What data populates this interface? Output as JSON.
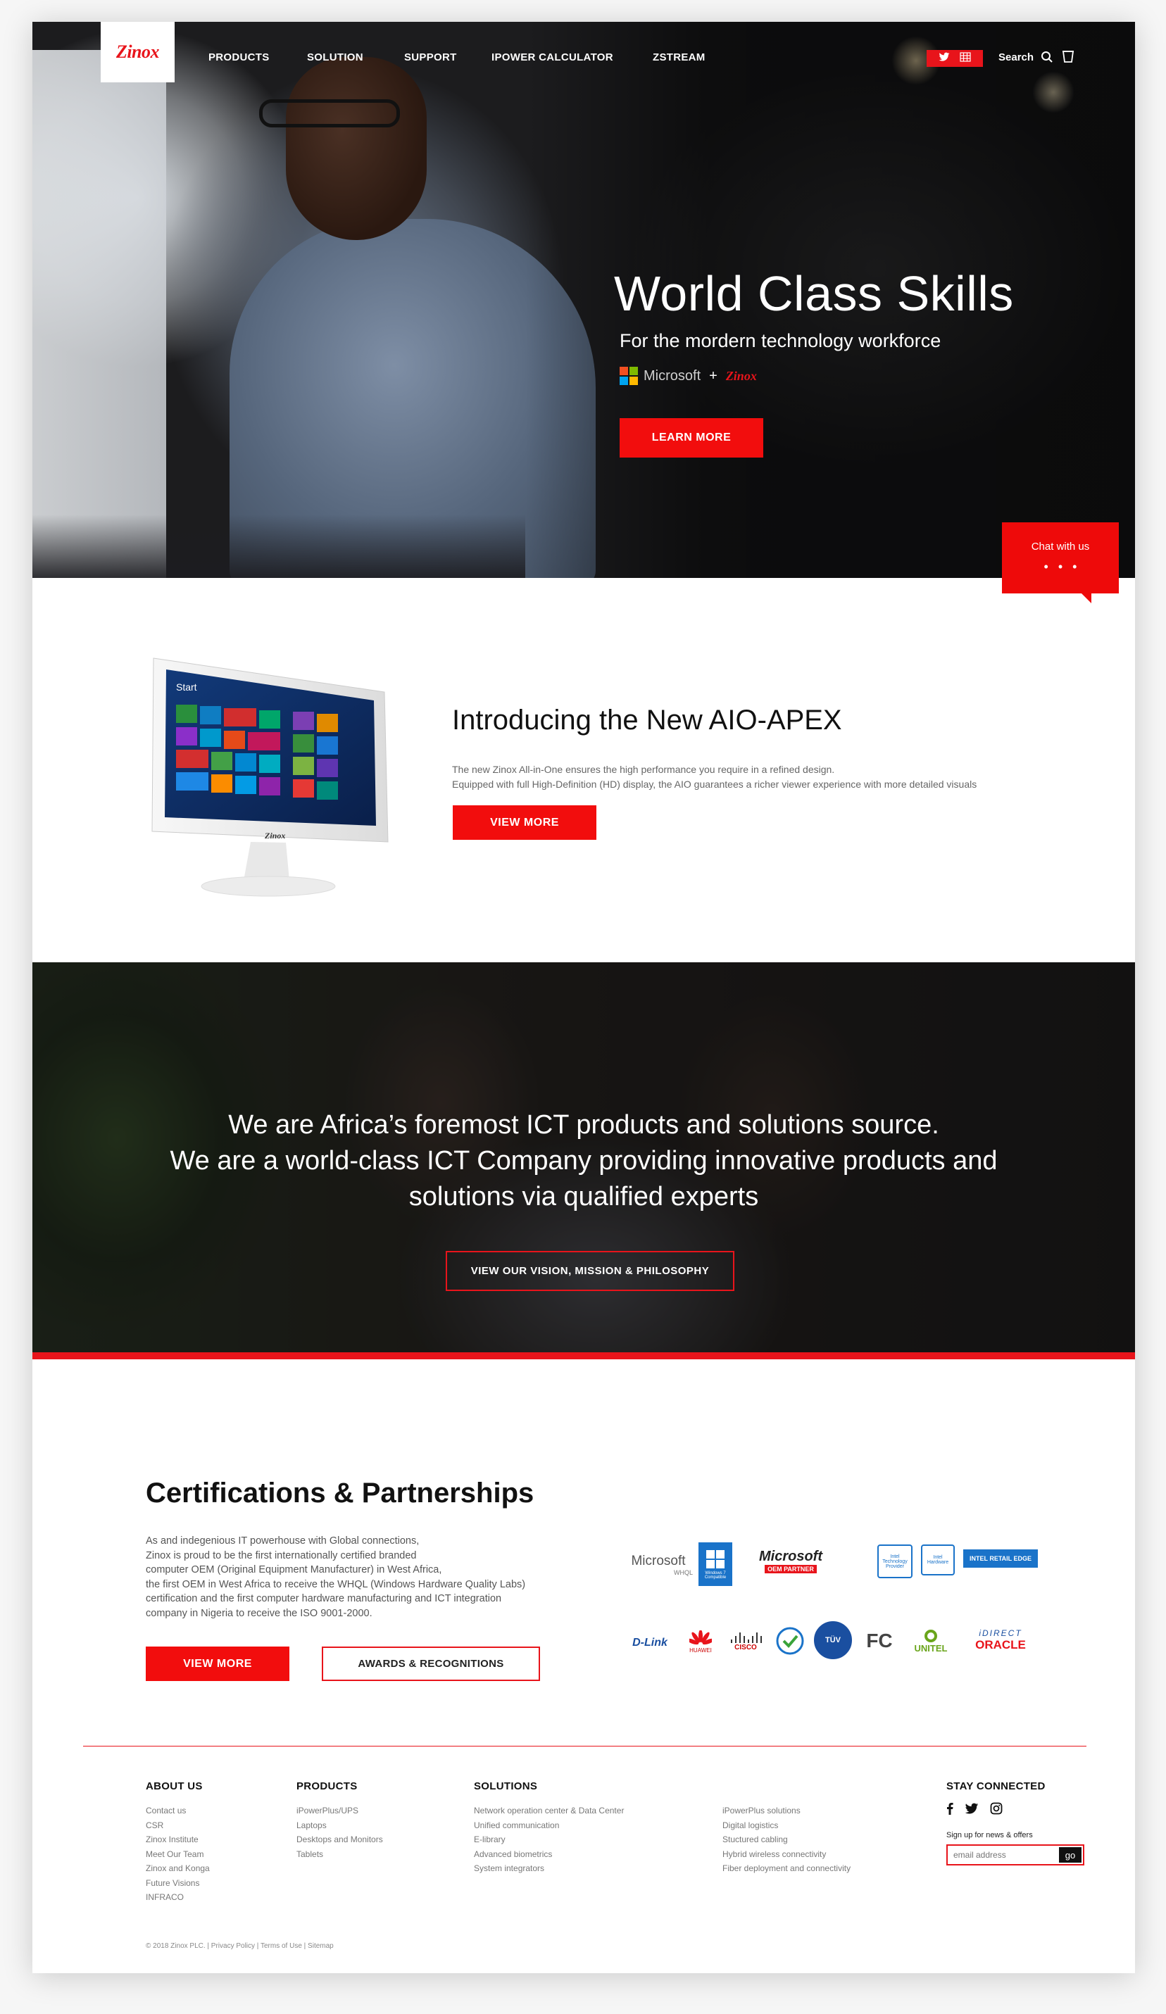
{
  "brand": {
    "logo_text": "Zinox",
    "accent_color": "#e8141b"
  },
  "nav": {
    "items": [
      {
        "label": "PRODUCTS"
      },
      {
        "label": "SOLUTION"
      },
      {
        "label": "SUPPORT"
      },
      {
        "label": "IPOWER CALCULATOR"
      },
      {
        "label": "ZSTREAM"
      }
    ],
    "social_icons": [
      "twitter-icon",
      "grid-icon"
    ],
    "search_label": "Search",
    "search_icon": "search-icon",
    "cart_icon": "cart-icon"
  },
  "hero": {
    "title": "World Class Skills",
    "subtitle": "For the mordern technology workforce",
    "partner_microsoft": "Microsoft",
    "partner_plus": "+",
    "partner_zinox": "Zinox",
    "button_label": "LEARN MORE"
  },
  "chat": {
    "label": "Chat with us",
    "dots": "•••"
  },
  "aio": {
    "title": "Introducing the New AIO-APEX",
    "description_line1": "The new Zinox All-in-One ensures the high performance you require in a refined design.",
    "description_line2": "Equipped with full High-Definition (HD) display, the AIO guarantees a richer viewer experience with more detailed visuals",
    "button_label": "VIEW MORE",
    "screen_label": "Start",
    "monitor_brand": "Zinox"
  },
  "mission": {
    "line1": "We are Africa’s foremost ICT products and solutions source.",
    "line2": "We are a world-class ICT Company providing innovative products and",
    "line3": "solutions via qualified experts",
    "button_label": "VIEW OUR VISION, MISSION & PHILOSOPHY"
  },
  "certifications": {
    "title": "Certifications & Partnerships",
    "description": [
      "As and indegenious IT powerhouse with Global connections,",
      "Zinox is proud to be the first internationally certified branded",
      "computer OEM (Original Equipment Manufacturer) in West Africa,",
      "the first OEM in West Africa to receive the WHQL (Windows Hardware Quality Labs)",
      "certification and  the first computer hardware manufacturing and ICT integration",
      "company in Nigeria to receive the ISO 9001-2000."
    ],
    "button_view_more": "VIEW MORE",
    "button_awards": "AWARDS & RECOGNITIONS",
    "logos": {
      "microsoft_whql": {
        "name": "Microsoft",
        "sub": "WHQL"
      },
      "windows_compatible": "Windows 7 Compatible",
      "microsoft_oem": {
        "name": "Microsoft",
        "sub": "OEM PARTNER"
      },
      "intel_provider": "Intel Technology Provider",
      "intel_hardware": "Intel Hardware",
      "intel_retail": "INTEL RETAIL EDGE",
      "dlink": "D-Link",
      "huawei": "HUAWEI",
      "cisco": "CISCO",
      "tuv": "TÜV",
      "fc": "FC",
      "unitel": "UNITEL",
      "idirect": "iDIRECT",
      "oracle": "ORACLE"
    }
  },
  "footer": {
    "about": {
      "heading": "ABOUT US",
      "links": [
        "Contact us",
        "CSR",
        "Zinox Institute",
        "Meet Our Team",
        "Zinox and Konga",
        "Future Visions",
        "INFRACO"
      ]
    },
    "products": {
      "heading": "PRODUCTS",
      "links": [
        "iPowerPlus/UPS",
        "Laptops",
        "Desktops and Monitors",
        "Tablets"
      ]
    },
    "solutions": {
      "heading": "SOLUTIONS",
      "links_col1": [
        "Network operation center & Data Center",
        "Unified communication",
        "E-library",
        "Advanced biometrics",
        "System integrators"
      ],
      "links_col2": [
        "iPowerPlus solutions",
        "Digital logistics",
        "Stuctured cabling",
        "Hybrid wireless connectivity",
        "Fiber deployment and connectivity"
      ]
    },
    "stay_connected": {
      "heading": "STAY CONNECTED",
      "icons": [
        "facebook-icon",
        "twitter-icon",
        "instagram-icon"
      ],
      "signup_label": "Sign up for news & offers",
      "email_placeholder": "email address",
      "go_label": "go"
    },
    "copyright": "© 2018 Zinox PLC. | Privacy Policy | Terms of Use | Sitemap"
  }
}
